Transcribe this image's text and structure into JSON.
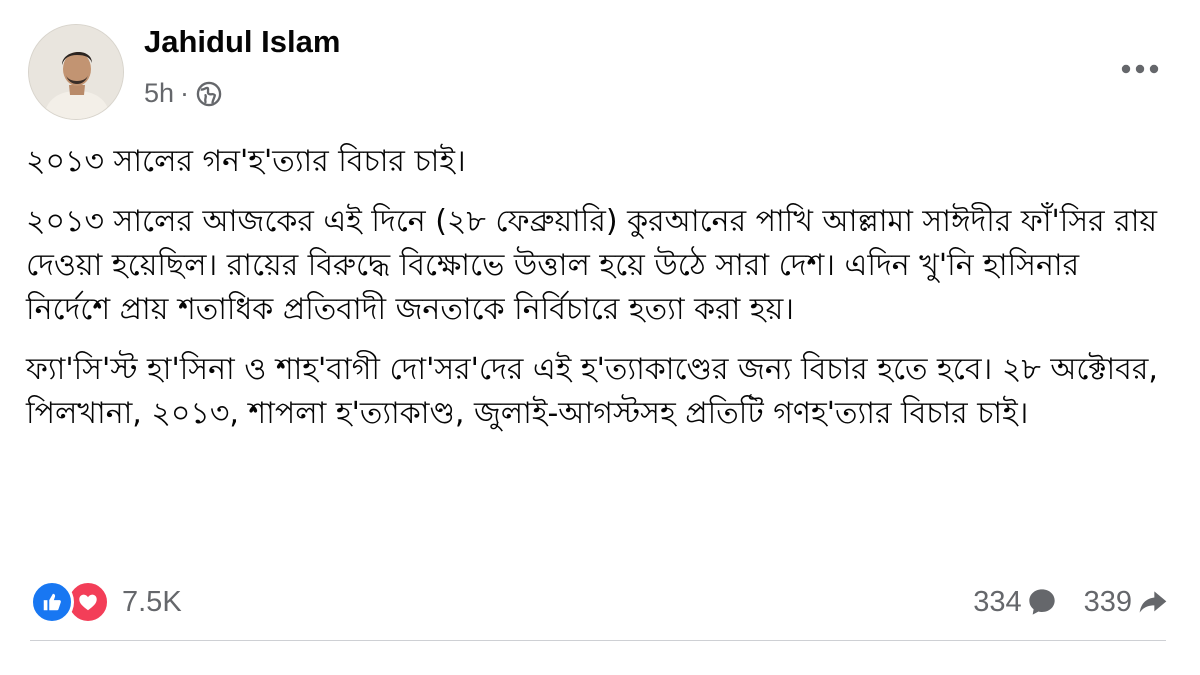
{
  "author": {
    "name": "Jahidul Islam",
    "time": "5h",
    "separator": "·",
    "audience_icon": "globe-icon",
    "avatar_icon": "profile-photo"
  },
  "post": {
    "paragraphs": [
      "২০১৩ সালের গন'হ'ত্যার বিচার চাই।",
      "২০১৩ সালের আজকের এই দিনে (২৮ ফেব্রুয়ারি) কুরআনের পাখি আল্লামা সাঈদীর ফাঁ'সির রায় দেওয়া হয়েছিল। রায়ের বিরুদ্ধে বিক্ষোভে উত্তাল হয়ে উঠে সারা দেশ। এদিন খু'নি হাসিনার নির্দেশে প্রায় শতাধিক প্রতিবাদী জনতাকে নির্বিচারে হত্যা করা হয়।",
      "ফ্যা'সি'স্ট হা'সিনা ও শাহ'বাগী দো'সর'দের এই হ'ত্যাকাণ্ডের জন্য বিচার হতে হবে। ২৮ অক্টোবর, পিলখানা, ২০১৩, শাপলা হ'ত্যাকাণ্ড, জুলাই-আগস্টসহ প্রতিটি গণহ'ত্যার বিচার চাই।"
    ]
  },
  "footer": {
    "reaction_count": "7.5K",
    "comment_count": "334",
    "share_count": "339",
    "icons": [
      "like-icon",
      "love-icon",
      "comment-icon",
      "share-icon",
      "more-icon"
    ]
  },
  "colors": {
    "like": "#1877f2",
    "love": "#f33e58",
    "secondary_text": "#65676b",
    "divider": "#ced0d4"
  }
}
